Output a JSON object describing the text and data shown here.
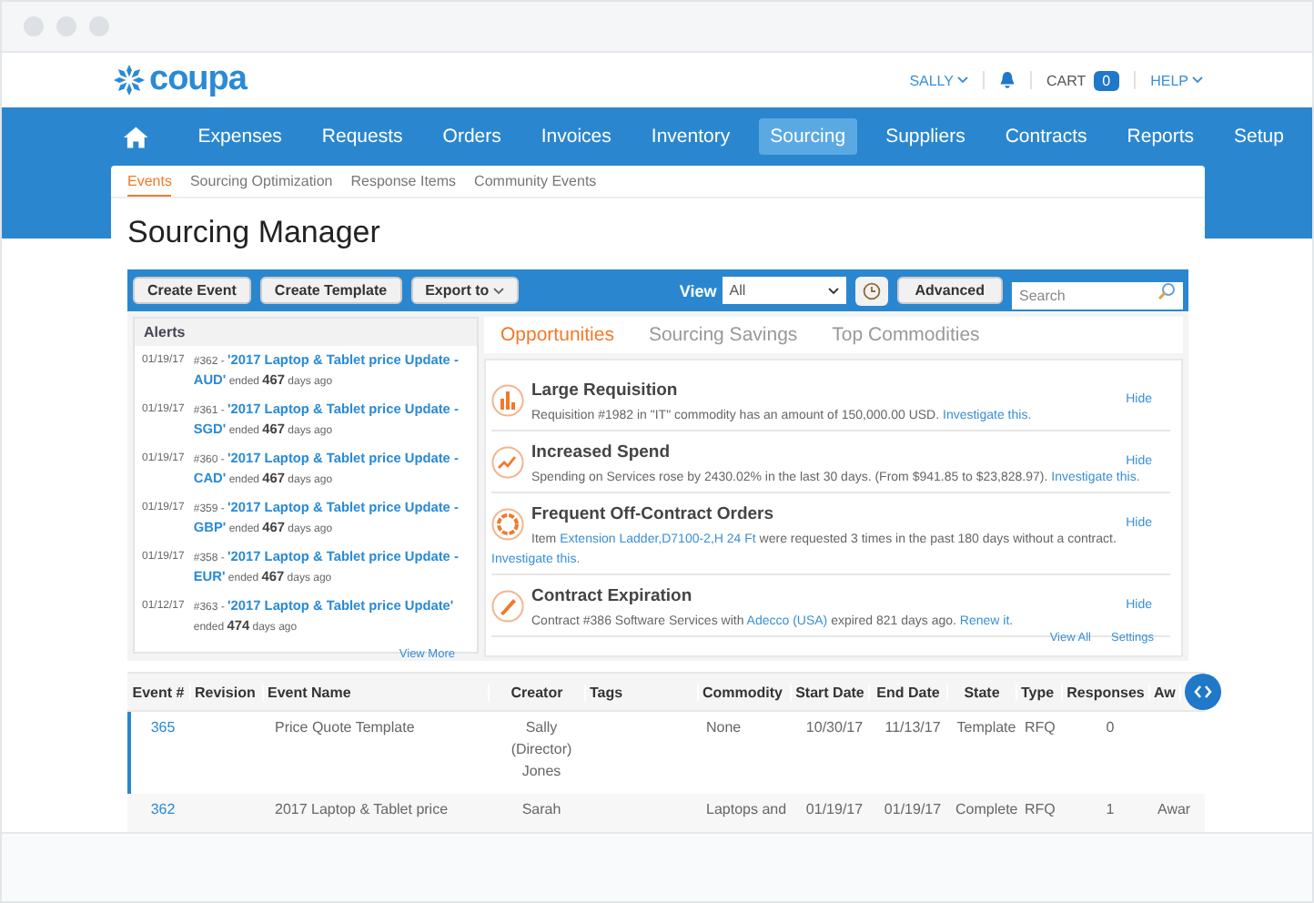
{
  "header": {
    "logo": "coupa",
    "user_menu": "SALLY",
    "cart_label": "CART",
    "cart_count": "0",
    "help_menu": "HELP"
  },
  "nav": [
    {
      "label": "Expenses",
      "selected": false
    },
    {
      "label": "Requests",
      "selected": false
    },
    {
      "label": "Orders",
      "selected": false
    },
    {
      "label": "Invoices",
      "selected": false
    },
    {
      "label": "Inventory",
      "selected": false
    },
    {
      "label": "Sourcing",
      "selected": true
    },
    {
      "label": "Suppliers",
      "selected": false
    },
    {
      "label": "Contracts",
      "selected": false
    },
    {
      "label": "Reports",
      "selected": false
    },
    {
      "label": "Setup",
      "selected": false
    }
  ],
  "subnav": [
    {
      "label": "Events",
      "selected": true
    },
    {
      "label": "Sourcing Optimization",
      "selected": false
    },
    {
      "label": "Response Items",
      "selected": false
    },
    {
      "label": "Community Events",
      "selected": false
    }
  ],
  "page_title": "Sourcing Manager",
  "toolbar": {
    "buttons": [
      "Create Event",
      "Create Template"
    ],
    "export_menu": "Export to",
    "view_label": "View",
    "view_value": "All",
    "advanced_button": "Advanced",
    "search_placeholder": "Search"
  },
  "alerts": {
    "title": "Alerts",
    "items": [
      {
        "date": "01/19/17",
        "number": "#362 -",
        "link": "'2017 Laptop & Tablet price Update - AUD'",
        "status": "ended **467** days ago"
      },
      {
        "date": "01/19/17",
        "number": "#361 -",
        "link": "'2017 Laptop & Tablet price Update - SGD'",
        "status": "ended **467** days ago"
      },
      {
        "date": "01/19/17",
        "number": "#360 -",
        "link": "'2017 Laptop & Tablet price Update - CAD'",
        "status": "ended **467** days ago"
      },
      {
        "date": "01/19/17",
        "number": "#359 -",
        "link": "'2017 Laptop & Tablet price Update - GBP'",
        "status": "ended **467** days ago"
      },
      {
        "date": "01/19/17",
        "number": "#358 -",
        "link": "'2017 Laptop & Tablet price Update - EUR'",
        "status": "ended **467** days ago"
      },
      {
        "date": "01/12/17",
        "number": "#363 -",
        "link": "'2017 Laptop & Tablet price Update'",
        "status": "ended **474** days ago"
      }
    ],
    "view_more": "View More"
  },
  "tabs": [
    {
      "label": "Opportunities",
      "selected": true
    },
    {
      "label": "Sourcing Savings",
      "selected": false
    },
    {
      "label": "Top Commodities",
      "selected": false
    }
  ],
  "opportunities": {
    "items": [
      {
        "kind": "requisition",
        "title": "Large Requisition",
        "parts": [
          {
            "text": "Requisition #1982 in \"IT\" commodity has an amount of 150,000.00 USD. "
          },
          {
            "link": "Investigate this."
          }
        ],
        "hide": "Hide"
      },
      {
        "kind": "spend",
        "title": "Increased Spend",
        "parts": [
          {
            "text": "Spending on Services rose by 2430.02% in the last 30 days. (From $941.85 to $23,828.97). "
          },
          {
            "link": "Investigate this."
          }
        ],
        "hide": "Hide"
      },
      {
        "kind": "off_contract",
        "title": "Frequent Off-Contract Orders",
        "parts": [
          {
            "text": "Item "
          },
          {
            "link": "Extension Ladder,D7100-2,H 24 Ft"
          },
          {
            "text": " were requested 3 times in the past 180 days without a contract. "
          },
          {
            "link": "Investigate this."
          }
        ],
        "hide": "Hide"
      },
      {
        "kind": "expiration",
        "title": "Contract Expiration",
        "parts": [
          {
            "text": "Contract #386 Software Services with "
          },
          {
            "link": "Adecco (USA)"
          },
          {
            "text": " expired 821 days ago. "
          },
          {
            "link": "Renew it."
          }
        ],
        "hide": "Hide"
      }
    ],
    "view_all": "View All",
    "settings": "Settings"
  },
  "table": {
    "columns": [
      "Event #",
      "Revision",
      "Event Name",
      "Creator",
      "Tags",
      "Commodity",
      "Start Date",
      "End Date",
      "State",
      "Type",
      "Responses",
      "Aw"
    ],
    "rows": [
      {
        "selected": true,
        "event_number": "365",
        "event_name": "Price Quote Template",
        "creator": "Sally (Director) Jones",
        "commodity": "None",
        "start_date": "10/30/17",
        "end_date": "11/13/17",
        "state": "Template",
        "type": "RFQ",
        "responses": "0"
      },
      {
        "selected": false,
        "event_number": "362",
        "event_name": "2017 Laptop & Tablet price",
        "creator": "Sarah",
        "commodity": "Laptops and",
        "start_date": "01/19/17",
        "end_date": "01/19/17",
        "state": "Complete",
        "type": "RFQ",
        "responses": "1",
        "column_12": "Awar"
      }
    ]
  }
}
